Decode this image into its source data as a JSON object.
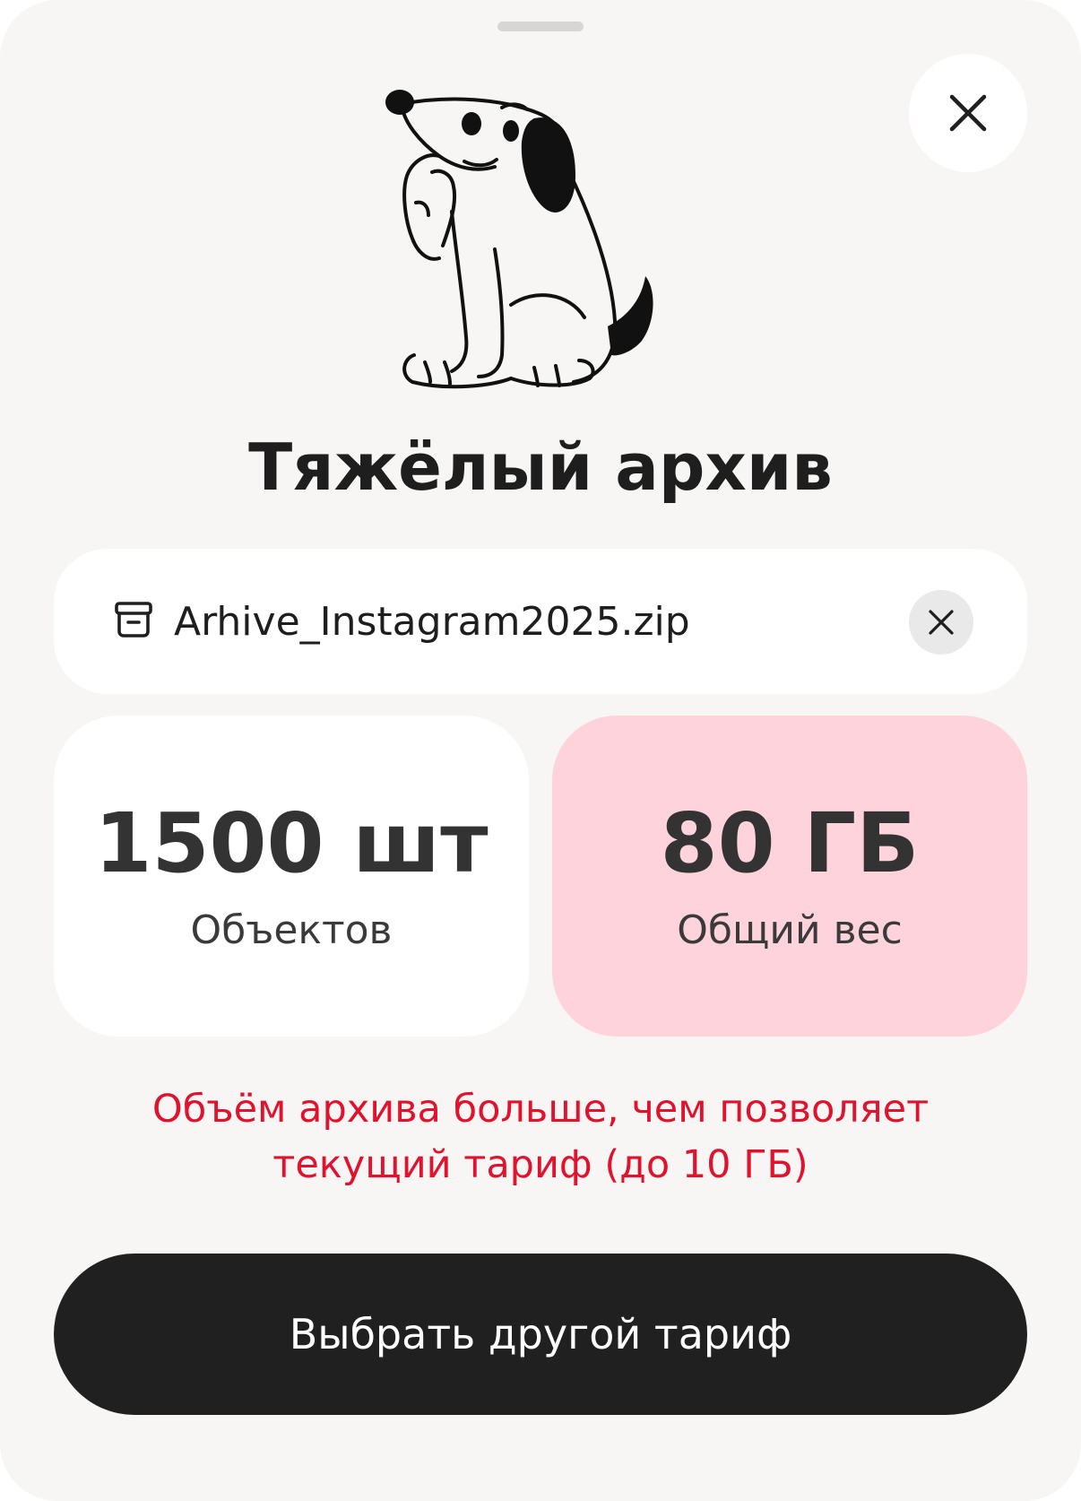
{
  "title": "Тяжёлый архив",
  "file": {
    "name": "Arhive_Instagram2025.zip",
    "icon": "archive-box-icon"
  },
  "stats": {
    "objects": {
      "value": "1500 шт",
      "label": "Объектов"
    },
    "weight": {
      "value": "80 ГБ",
      "label": "Общий вес",
      "highlight_color": "#ffd3dc"
    }
  },
  "warning": {
    "line1": "Объём архива больше, чем позволяет",
    "line2": "текущий тариф (до 10 ГБ)",
    "color": "#e0132f"
  },
  "cta": {
    "label": "Выбрать другой тариф",
    "background": "#202020"
  },
  "icons": {
    "close": "close-icon",
    "remove_file": "close-icon",
    "illustration": "thinking-dog-illustration"
  }
}
